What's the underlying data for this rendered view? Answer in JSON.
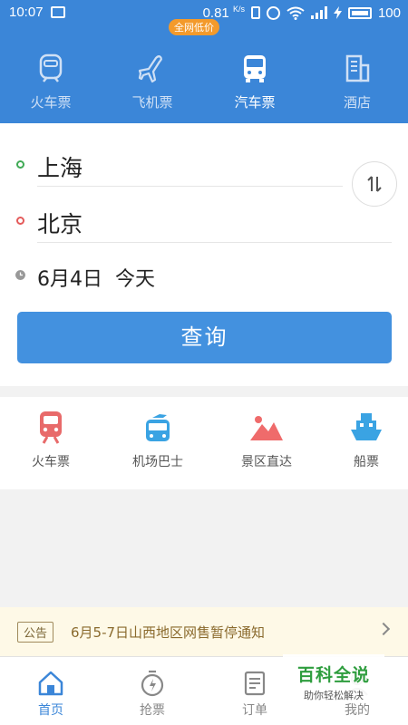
{
  "status_bar": {
    "time": "10:07",
    "speed": "0.81",
    "speed_unit": "K/s",
    "battery": "100"
  },
  "top_tabs": [
    {
      "label": "火车票",
      "icon": "train-icon"
    },
    {
      "label": "飞机票",
      "icon": "airplane-icon"
    },
    {
      "label": "汽车票",
      "icon": "bus-icon",
      "active": true
    },
    {
      "label": "酒店",
      "icon": "hotel-icon"
    }
  ],
  "badge": "全网低价",
  "search": {
    "from": "上海",
    "to": "北京",
    "date": "6月4日  今天",
    "query_label": "查询"
  },
  "quick_links": [
    {
      "label": "火车票",
      "icon": "train-icon",
      "color": "#e86a6a"
    },
    {
      "label": "机场巴士",
      "icon": "airport-bus-icon",
      "color": "#3aa3e3"
    },
    {
      "label": "景区直达",
      "icon": "mountain-icon",
      "color": "#ef6b6b"
    },
    {
      "label": "船票",
      "icon": "ship-icon",
      "color": "#3aa3e3"
    }
  ],
  "notice": {
    "tag": "公告",
    "text": "6月5-7日山西地区网售暂停通知"
  },
  "bottom_nav": [
    {
      "label": "首页",
      "icon": "home-icon",
      "active": true
    },
    {
      "label": "抢票",
      "icon": "grab-ticket-icon"
    },
    {
      "label": "订单",
      "icon": "order-icon"
    },
    {
      "label": "我的",
      "icon": "profile-icon"
    }
  ],
  "watermark": {
    "title": "百科全说",
    "subtitle": "助你轻松解决"
  },
  "colors": {
    "brand_blue": "#3b86d8",
    "button_blue": "#4391df",
    "badge_orange": "#f39a2b",
    "notice_bg": "#fef9e7"
  }
}
